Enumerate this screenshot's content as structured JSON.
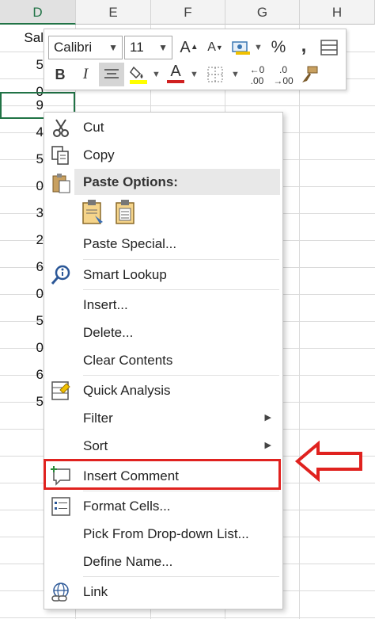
{
  "sheet": {
    "columns": [
      "D",
      "E",
      "F",
      "G",
      "H"
    ],
    "header_cell": "Sal",
    "cells": [
      "5",
      "0",
      "9",
      "4",
      "5",
      "0",
      "3",
      "2",
      "6",
      "0",
      "5",
      "0",
      "6",
      "5"
    ]
  },
  "mini_toolbar": {
    "font_name": "Calibri",
    "font_size": "11",
    "increase_font": "A",
    "decrease_font": "A",
    "percent": "%",
    "comma": ",",
    "bold": "B",
    "italic": "I",
    "font_color_letter": "A",
    "increase_decimal": ".00",
    "decrease_decimal": ".0",
    "accent_font": "#d02020",
    "accent_fill": "#ffff00"
  },
  "context_menu": {
    "items": [
      {
        "label": "Cut",
        "icon": "scissors-icon"
      },
      {
        "label": "Copy",
        "icon": "copy-icon"
      },
      {
        "label": "Paste Options:",
        "icon": "paste-icon"
      },
      {
        "label": "Paste Special...",
        "icon": ""
      },
      {
        "label": "Smart Lookup",
        "icon": "smart-lookup-icon"
      },
      {
        "label": "Insert...",
        "icon": ""
      },
      {
        "label": "Delete...",
        "icon": ""
      },
      {
        "label": "Clear Contents",
        "icon": ""
      },
      {
        "label": "Quick Analysis",
        "icon": "quick-analysis-icon"
      },
      {
        "label": "Filter",
        "icon": ""
      },
      {
        "label": "Sort",
        "icon": ""
      },
      {
        "label": "Insert Comment",
        "icon": "insert-comment-icon"
      },
      {
        "label": "Format Cells...",
        "icon": "format-cells-icon"
      },
      {
        "label": "Pick From Drop-down List...",
        "icon": ""
      },
      {
        "label": "Define Name...",
        "icon": ""
      },
      {
        "label": "Link",
        "icon": "link-icon"
      }
    ],
    "highlight_color": "#e0221f"
  }
}
